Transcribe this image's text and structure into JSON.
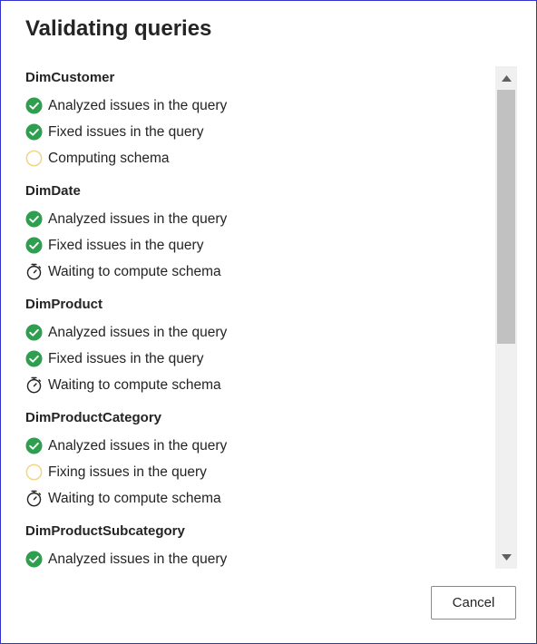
{
  "dialog": {
    "title": "Validating queries",
    "cancel_label": "Cancel"
  },
  "colors": {
    "success": "#2e9e4f",
    "pending": "#f0d68a",
    "border": "#3333cc"
  },
  "groups": [
    {
      "name": "DimCustomer",
      "steps": [
        {
          "status": "done",
          "icon": "check-circle-icon",
          "label": "Analyzed issues in the query"
        },
        {
          "status": "done",
          "icon": "check-circle-icon",
          "label": "Fixed issues in the query"
        },
        {
          "status": "in-progress",
          "icon": "spinner-icon",
          "label": "Computing schema"
        }
      ]
    },
    {
      "name": "DimDate",
      "steps": [
        {
          "status": "done",
          "icon": "check-circle-icon",
          "label": "Analyzed issues in the query"
        },
        {
          "status": "done",
          "icon": "check-circle-icon",
          "label": "Fixed issues in the query"
        },
        {
          "status": "waiting",
          "icon": "stopwatch-icon",
          "label": "Waiting to compute schema"
        }
      ]
    },
    {
      "name": "DimProduct",
      "steps": [
        {
          "status": "done",
          "icon": "check-circle-icon",
          "label": "Analyzed issues in the query"
        },
        {
          "status": "done",
          "icon": "check-circle-icon",
          "label": "Fixed issues in the query"
        },
        {
          "status": "waiting",
          "icon": "stopwatch-icon",
          "label": "Waiting to compute schema"
        }
      ]
    },
    {
      "name": "DimProductCategory",
      "steps": [
        {
          "status": "done",
          "icon": "check-circle-icon",
          "label": "Analyzed issues in the query"
        },
        {
          "status": "in-progress",
          "icon": "spinner-icon",
          "label": "Fixing issues in the query"
        },
        {
          "status": "waiting",
          "icon": "stopwatch-icon",
          "label": "Waiting to compute schema"
        }
      ]
    },
    {
      "name": "DimProductSubcategory",
      "steps": [
        {
          "status": "done",
          "icon": "check-circle-icon",
          "label": "Analyzed issues in the query"
        }
      ]
    }
  ]
}
